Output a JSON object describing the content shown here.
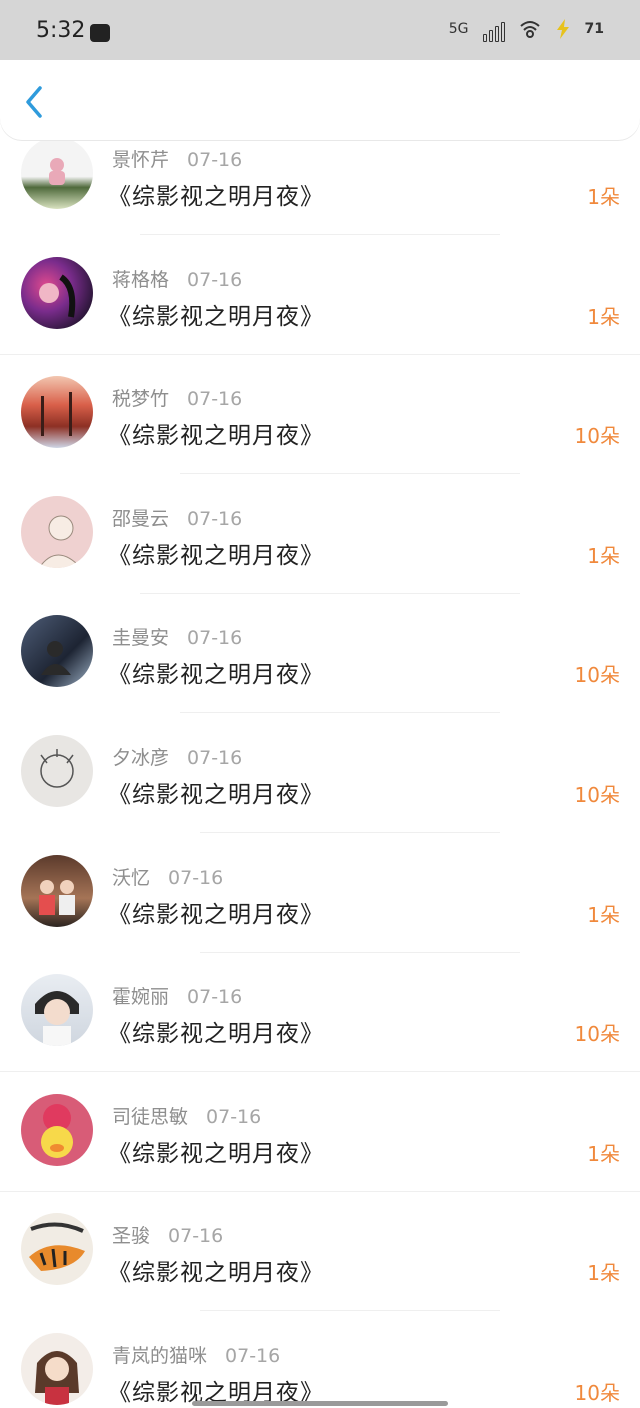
{
  "status_bar": {
    "time": "5:32",
    "network": "5G",
    "battery": "71"
  },
  "items": [
    {
      "name": "景怀芹",
      "date": "07-16",
      "title": "《综影视之明月夜》",
      "amount": "1朵"
    },
    {
      "name": "蒋格格",
      "date": "07-16",
      "title": "《综影视之明月夜》",
      "amount": "1朵"
    },
    {
      "name": "税梦竹",
      "date": "07-16",
      "title": "《综影视之明月夜》",
      "amount": "10朵"
    },
    {
      "name": "邵曼云",
      "date": "07-16",
      "title": "《综影视之明月夜》",
      "amount": "1朵"
    },
    {
      "name": "圭曼安",
      "date": "07-16",
      "title": "《综影视之明月夜》",
      "amount": "10朵"
    },
    {
      "name": "夕冰彦",
      "date": "07-16",
      "title": "《综影视之明月夜》",
      "amount": "10朵"
    },
    {
      "name": "沃忆",
      "date": "07-16",
      "title": "《综影视之明月夜》",
      "amount": "1朵"
    },
    {
      "name": "霍婉丽",
      "date": "07-16",
      "title": "《综影视之明月夜》",
      "amount": "10朵"
    },
    {
      "name": "司徒思敏",
      "date": "07-16",
      "title": "《综影视之明月夜》",
      "amount": "1朵"
    },
    {
      "name": "圣骏",
      "date": "07-16",
      "title": "《综影视之明月夜》",
      "amount": "1朵"
    },
    {
      "name": "青岚的猫咪",
      "date": "07-16",
      "title": "《综影视之明月夜》",
      "amount": "10朵"
    }
  ],
  "colors": {
    "accent_orange": "#f0893c",
    "back_arrow_blue": "#2f9bdc",
    "name_gray": "#8e8e8e"
  }
}
